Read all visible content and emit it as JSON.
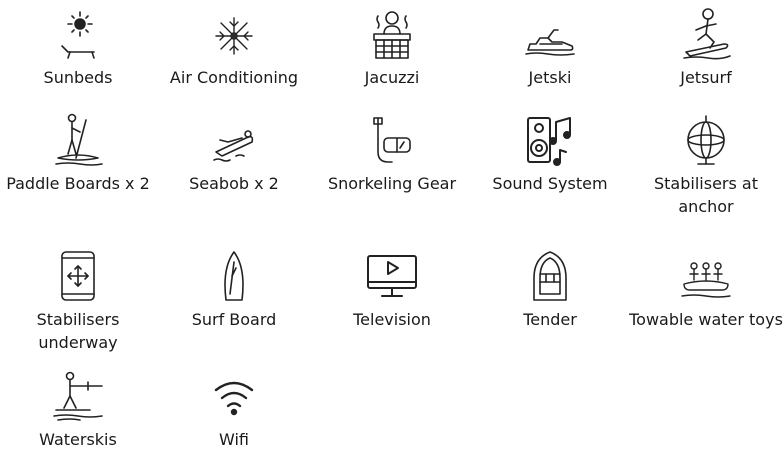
{
  "amenities": [
    {
      "label": "Sunbeds",
      "icon": "sunbed-icon"
    },
    {
      "label": "Air Conditioning",
      "icon": "snowflake-icon"
    },
    {
      "label": "Jacuzzi",
      "icon": "jacuzzi-icon"
    },
    {
      "label": "Jetski",
      "icon": "jetski-icon"
    },
    {
      "label": "Jetsurf",
      "icon": "jetsurf-icon"
    },
    {
      "label": "Paddle Boards x 2",
      "icon": "paddle-board-icon"
    },
    {
      "label": "Seabob x 2",
      "icon": "seabob-icon"
    },
    {
      "label": "Snorkeling Gear",
      "icon": "snorkel-icon"
    },
    {
      "label": "Sound System",
      "icon": "speaker-music-icon"
    },
    {
      "label": "Stabilisers at anchor",
      "icon": "gyroscope-icon"
    },
    {
      "label": "Stabilisers underway",
      "icon": "phone-move-icon"
    },
    {
      "label": "Surf Board",
      "icon": "surfboard-icon"
    },
    {
      "label": "Television",
      "icon": "television-icon"
    },
    {
      "label": "Tender",
      "icon": "tender-boat-icon"
    },
    {
      "label": "Towable water toys",
      "icon": "towable-toy-icon"
    },
    {
      "label": "Waterskis",
      "icon": "waterski-icon"
    },
    {
      "label": "Wifi",
      "icon": "wifi-icon"
    }
  ]
}
